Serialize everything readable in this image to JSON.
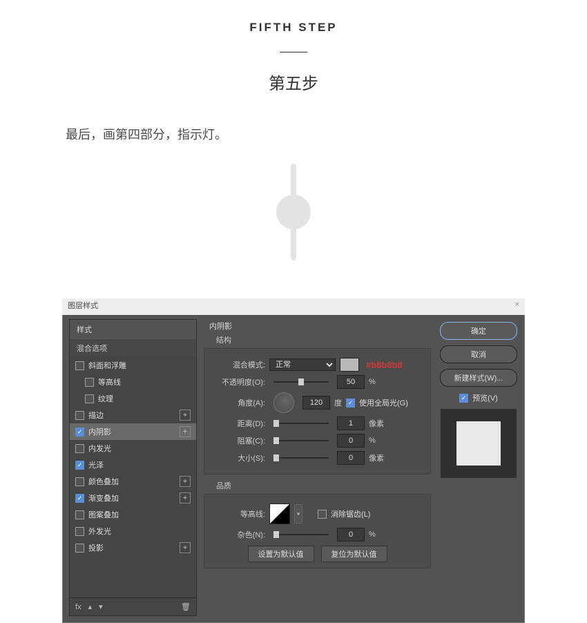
{
  "header": {
    "en": "FIFTH  STEP",
    "cn": "第五步"
  },
  "instruction": "最后，画第四部分，指示灯。",
  "dialog": {
    "title": "图层样式",
    "styles_header": "样式",
    "blend_options": "混合选项",
    "effects": {
      "bevel": "斜面和浮雕",
      "contour": "等高线",
      "texture": "纹理",
      "stroke": "描边",
      "inner_shadow": "内阴影",
      "inner_glow": "内发光",
      "satin": "光泽",
      "color_overlay": "颜色叠加",
      "gradient_overlay": "渐变叠加",
      "pattern_overlay": "图案叠加",
      "outer_glow": "外发光",
      "drop_shadow": "投影"
    },
    "fx_label": "fx",
    "section": {
      "title": "内阴影",
      "structure": "结构",
      "quality": "品质"
    },
    "fields": {
      "blend_mode": {
        "label": "混合模式:",
        "value": "正常"
      },
      "color_note": "#b8b8b8",
      "opacity": {
        "label": "不透明度(O):",
        "value": "50",
        "unit": "%"
      },
      "angle": {
        "label": "角度(A):",
        "value": "120",
        "unit": "度"
      },
      "global_light": "使用全局光(G)",
      "distance": {
        "label": "距离(D):",
        "value": "1",
        "unit": "像素"
      },
      "choke": {
        "label": "阻塞(C):",
        "value": "0",
        "unit": "%"
      },
      "size": {
        "label": "大小(S):",
        "value": "0",
        "unit": "像素"
      },
      "contour": {
        "label": "等高线:"
      },
      "anti_alias": "消除锯齿(L)",
      "noise": {
        "label": "杂色(N):",
        "value": "0",
        "unit": "%"
      }
    },
    "buttons": {
      "set_default": "设置为默认值",
      "reset_default": "复位为默认值",
      "ok": "确定",
      "cancel": "取消",
      "new_style": "新建样式(W)...",
      "preview": "预览(V)"
    }
  }
}
